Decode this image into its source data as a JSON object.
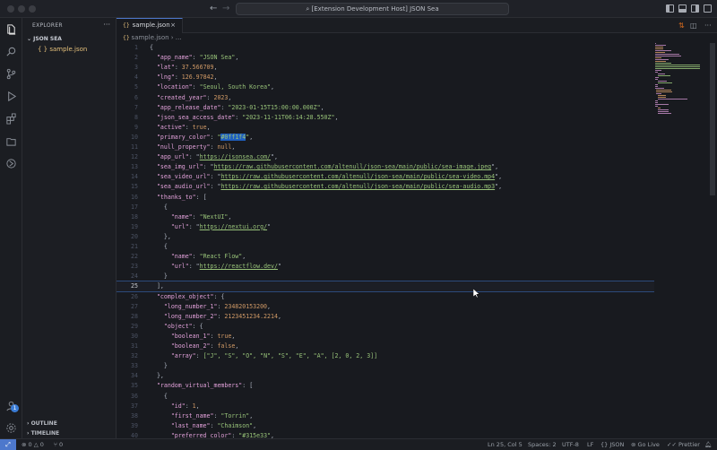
{
  "window": {
    "title": "[Extension Development Host] JSON Sea"
  },
  "explorer": {
    "header": "EXPLORER",
    "folder": "JSON SEA",
    "file": "sample.json",
    "outline": "OUTLINE",
    "timeline": "TIMELINE"
  },
  "tab": {
    "label": "sample.json",
    "close": "×"
  },
  "breadcrumb": {
    "file": "sample.json",
    "more": "…"
  },
  "editor": {
    "lines": [
      {
        "n": "1",
        "t": "{"
      },
      {
        "n": "2",
        "k": "\"app_name\"",
        "v": "\"JSON Sea\"",
        "vt": "s",
        "tail": ","
      },
      {
        "n": "3",
        "k": "\"lat\"",
        "v": "37.566709",
        "vt": "n",
        "tail": ","
      },
      {
        "n": "4",
        "k": "\"lng\"",
        "v": "126.97842",
        "vt": "n",
        "tail": ","
      },
      {
        "n": "5",
        "k": "\"location\"",
        "v": "\"Seoul, South Korea\"",
        "vt": "s",
        "tail": ","
      },
      {
        "n": "6",
        "k": "\"created_year\"",
        "v": "2023",
        "vt": "n",
        "tail": ","
      },
      {
        "n": "7",
        "k": "\"app_release_date\"",
        "v": "\"2023-01-15T15:00:00.000Z\"",
        "vt": "s",
        "tail": ","
      },
      {
        "n": "8",
        "k": "\"json_sea_access_date\"",
        "v": "\"2023-11-11T06:14:28.550Z\"",
        "vt": "s",
        "tail": ","
      },
      {
        "n": "9",
        "k": "\"active\"",
        "v": "true",
        "vt": "n",
        "tail": ","
      },
      {
        "n": "10",
        "k": "\"primary_color\"",
        "v": "\"#0ff1f4\"",
        "vt": "hl",
        "tail": ","
      },
      {
        "n": "11",
        "k": "\"null_property\"",
        "v": "null",
        "vt": "n",
        "tail": ","
      },
      {
        "n": "12",
        "k": "\"app_url\"",
        "v": "https://jsonsea.com/",
        "vt": "u",
        "tail": ","
      },
      {
        "n": "13",
        "k": "\"sea_img_url\"",
        "v": "https://raw.githubusercontent.com/altenull/json-sea/main/public/sea-image.jpeg",
        "vt": "u",
        "tail": ","
      },
      {
        "n": "14",
        "k": "\"sea_video_url\"",
        "v": "https://raw.githubusercontent.com/altenull/json-sea/main/public/sea-video.mp4",
        "vt": "u",
        "tail": ","
      },
      {
        "n": "15",
        "k": "\"sea_audio_url\"",
        "v": "https://raw.githubusercontent.com/altenull/json-sea/main/public/sea-audio.mp3",
        "vt": "u",
        "tail": ","
      },
      {
        "n": "16",
        "k": "\"thanks_to\"",
        "v": "[",
        "vt": "p",
        "tail": ""
      },
      {
        "n": "17",
        "t": "    {"
      },
      {
        "n": "18",
        "ind": "      ",
        "k": "\"name\"",
        "v": "\"NextUI\"",
        "vt": "s",
        "tail": ","
      },
      {
        "n": "19",
        "ind": "      ",
        "k": "\"url\"",
        "v": "https://nextui.org/",
        "vt": "u",
        "tail": ""
      },
      {
        "n": "20",
        "t": "    },"
      },
      {
        "n": "21",
        "t": "    {"
      },
      {
        "n": "22",
        "ind": "      ",
        "k": "\"name\"",
        "v": "\"React Flow\"",
        "vt": "s",
        "tail": ","
      },
      {
        "n": "23",
        "ind": "      ",
        "k": "\"url\"",
        "v": "https://reactflow.dev/",
        "vt": "u",
        "tail": ""
      },
      {
        "n": "24",
        "t": "    }"
      },
      {
        "n": "25",
        "t": "  ],"
      },
      {
        "n": "26",
        "k": "\"complex_object\"",
        "v": "{",
        "vt": "p",
        "tail": ""
      },
      {
        "n": "27",
        "ind": "    ",
        "k": "\"long_number_1\"",
        "v": "234820153200",
        "vt": "n",
        "tail": ","
      },
      {
        "n": "28",
        "ind": "    ",
        "k": "\"long_number_2\"",
        "v": "2123451234.2214",
        "vt": "n",
        "tail": ","
      },
      {
        "n": "29",
        "ind": "    ",
        "k": "\"object\"",
        "v": "{",
        "vt": "p",
        "tail": ""
      },
      {
        "n": "30",
        "ind": "      ",
        "k": "\"boolean_1\"",
        "v": "true",
        "vt": "n",
        "tail": ","
      },
      {
        "n": "31",
        "ind": "      ",
        "k": "\"boolean_2\"",
        "v": "false",
        "vt": "n",
        "tail": ","
      },
      {
        "n": "32",
        "ind": "      ",
        "k": "\"array\"",
        "v": "[\"J\", \"S\", \"O\", \"N\", \"S\", \"E\", \"A\", [2, 0, 2, 3]]",
        "vt": "arr",
        "tail": ""
      },
      {
        "n": "33",
        "t": "    }"
      },
      {
        "n": "34",
        "t": "  },"
      },
      {
        "n": "35",
        "k": "\"random_virtual_members\"",
        "v": "[",
        "vt": "p",
        "tail": ""
      },
      {
        "n": "36",
        "t": "    {"
      },
      {
        "n": "37",
        "ind": "      ",
        "k": "\"id\"",
        "v": "1",
        "vt": "n",
        "tail": ","
      },
      {
        "n": "38",
        "ind": "      ",
        "k": "\"first_name\"",
        "v": "\"Torrin\"",
        "vt": "s",
        "tail": ","
      },
      {
        "n": "39",
        "ind": "      ",
        "k": "\"last_name\"",
        "v": "\"Chaimson\"",
        "vt": "s",
        "tail": ","
      },
      {
        "n": "40",
        "ind": "      ",
        "k": "\"preferred_color\"",
        "v": "\"#315e33\"",
        "vt": "s",
        "tail": ","
      }
    ],
    "current_line": "25"
  },
  "statusbar": {
    "errors": "0",
    "warnings": "0",
    "ports": "0",
    "position": "Ln 25, Col 5",
    "spaces": "Spaces: 2",
    "encoding": "UTF-8",
    "eol": "LF",
    "language": "JSON",
    "golive": "Go Live",
    "prettier": "Prettier"
  },
  "notifications_badge": "1",
  "colors": {
    "accent": "#4d78cc",
    "string": "#98c379",
    "number": "#d19a66",
    "key": "#e0a0d8"
  }
}
